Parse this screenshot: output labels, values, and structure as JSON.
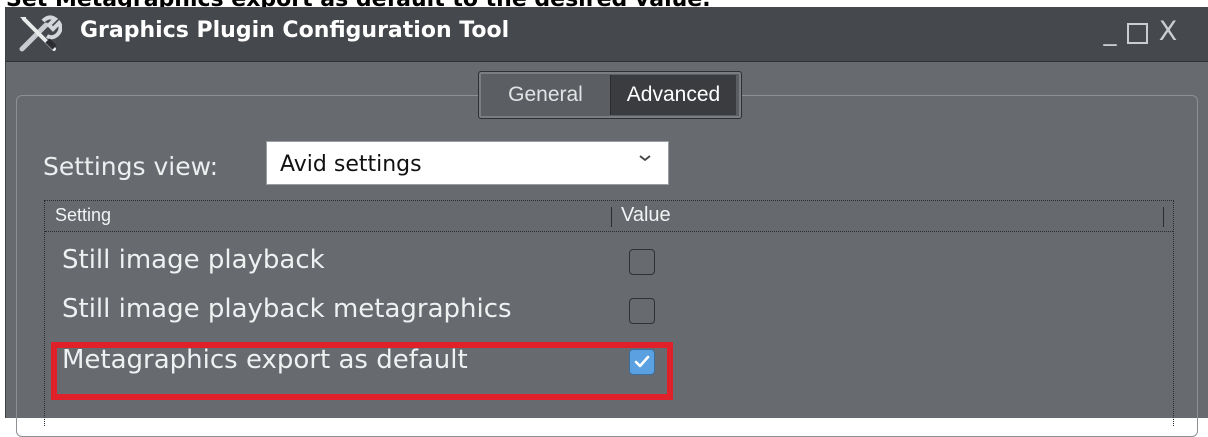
{
  "caption": "Set Metagraphics export as default to the desired value.",
  "window": {
    "title": "Graphics Plugin Configuration Tool",
    "controls": {
      "minimize": "_",
      "close": "X"
    }
  },
  "tabs": [
    {
      "label": "General",
      "active": false
    },
    {
      "label": "Advanced",
      "active": true
    }
  ],
  "settings_view": {
    "label": "Settings view:",
    "selected": "Avid settings"
  },
  "table": {
    "columns": [
      "Setting",
      "Value"
    ],
    "rows": [
      {
        "label": "Still image playback",
        "checked": false
      },
      {
        "label": "Still image playback metagraphics",
        "checked": false
      },
      {
        "label": "Metagraphics export as default",
        "checked": true
      }
    ]
  },
  "colors": {
    "highlight": "#e0212a",
    "checkbox_checked": "#5ba0e0",
    "window_bg": "#676a6e",
    "titlebar_bg": "#45484c"
  },
  "icons": [
    "tools-icon",
    "minimize-icon",
    "maximize-icon",
    "close-icon",
    "chevron-down-icon",
    "checkmark-icon"
  ]
}
